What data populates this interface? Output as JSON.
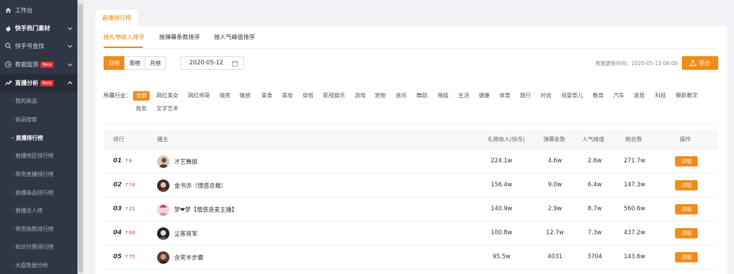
{
  "sidebar": {
    "items": [
      {
        "label": "工作台",
        "icon": "home-icon"
      },
      {
        "label": "快手热门素材",
        "icon": "fire-icon"
      },
      {
        "label": "快手号查找",
        "icon": "search-icon"
      },
      {
        "label": "数据监测",
        "icon": "monitor-icon",
        "badge": "New"
      },
      {
        "label": "直播分析",
        "icon": "trend-icon",
        "badge": "New"
      }
    ],
    "sub_items": [
      "· 我的商品",
      "· 商品搜索",
      "· 直播排行榜",
      "· 直播地区排行榜",
      "· 带货直播排行榜",
      "· 直播商品排行榜",
      "· 直播达人榜",
      "· 带货指数排行榜",
      "· 知识付费排行榜",
      "· 大盘数据分析"
    ]
  },
  "page_tab": "直播排行榜",
  "subtabs": [
    "按礼物收入排序",
    "按弹幕条数排序",
    "按人气峰值排序"
  ],
  "periods": [
    "日榜",
    "周榜",
    "月榜"
  ],
  "date": "2020-05-12",
  "update_time": "数据更新时间：2020-05-13 06:00",
  "export_label": "导出",
  "industry": {
    "label": "所属行业：",
    "row1": [
      "全部",
      "网红美女",
      "网红帅哥",
      "搞笑",
      "情感",
      "美食",
      "美妆",
      "穿搭",
      "影视娱乐",
      "游戏",
      "宠物",
      "音乐",
      "舞蹈",
      "萌娃",
      "生活",
      "健康",
      "体育",
      "旅行",
      "时尚",
      "母婴育儿",
      "教育",
      "汽车",
      "家居",
      "科技",
      "摄影教学"
    ],
    "row2": [
      "政务",
      "文学艺术"
    ]
  },
  "table": {
    "headers": [
      "排行",
      "播主",
      "礼物收入(快币)",
      "弹幕条数",
      "人气峰值",
      "粉丝数",
      "操作"
    ],
    "rows": [
      {
        "rank": "01",
        "rise": "↑6",
        "name": "才艺舞娘",
        "income": "224.1w",
        "danmu": "4.6w",
        "peak": "2.6w",
        "fans": "271.7w"
      },
      {
        "rank": "02",
        "rise": "↑74",
        "name": "金书亦（情感总裁）",
        "income": "156.4w",
        "danmu": "9.0w",
        "peak": "6.4w",
        "fans": "147.3w"
      },
      {
        "rank": "03",
        "rise": "↑21",
        "name": "梦❤梦【情感连麦主播】",
        "income": "140.9w",
        "danmu": "2.9w",
        "peak": "8.7w",
        "fans": "560.6w"
      },
      {
        "rank": "04",
        "rise": "↑60",
        "name": "尘客将军",
        "income": "100.8w",
        "danmu": "12.7w",
        "peak": "7.3w",
        "fans": "437.2w"
      },
      {
        "rank": "05",
        "rise": "↑75",
        "name": "含笑半步癫",
        "income": "95.5w",
        "danmu": "4031",
        "peak": "3704",
        "fans": "143.6w"
      }
    ],
    "detail_label": "详情"
  },
  "colors": {
    "accent": "#f08c1a",
    "sidebar_bg": "#2f3745",
    "rise_red": "#e8302f"
  }
}
